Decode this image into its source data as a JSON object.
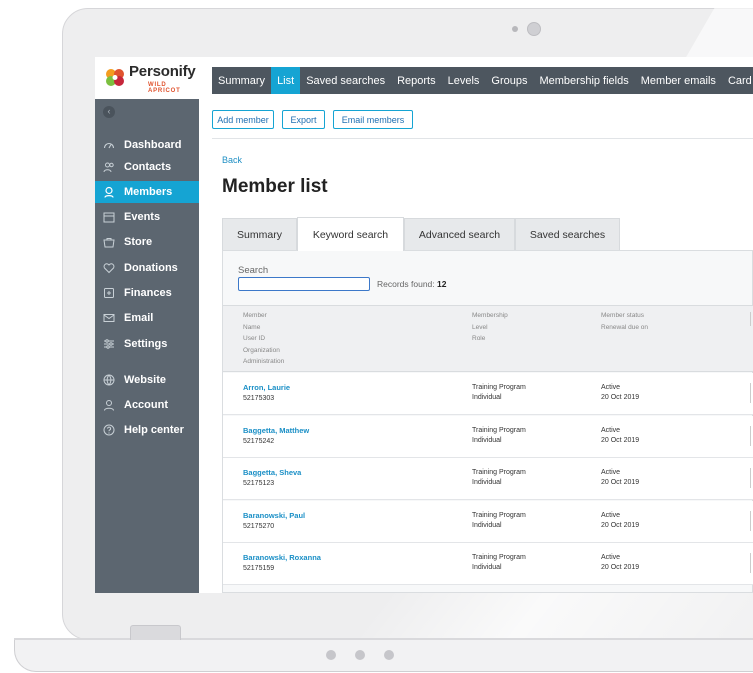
{
  "brand": {
    "name": "Personify",
    "sub": "WILD APRICOT"
  },
  "sidebar": {
    "collapse_glyph": "‹",
    "items": [
      {
        "label": "Dashboard",
        "icon": "dashboard-icon",
        "active": false
      },
      {
        "label": "Contacts",
        "icon": "contacts-icon",
        "active": false
      },
      {
        "label": "Members",
        "icon": "members-icon",
        "active": true
      },
      {
        "label": "Events",
        "icon": "calendar-icon",
        "active": false
      },
      {
        "label": "Store",
        "icon": "store-icon",
        "active": false
      },
      {
        "label": "Donations",
        "icon": "heart-icon",
        "active": false
      },
      {
        "label": "Finances",
        "icon": "finances-icon",
        "active": false
      },
      {
        "label": "Email",
        "icon": "email-icon",
        "active": false
      },
      {
        "label": "Settings",
        "icon": "settings-icon",
        "active": false
      },
      {
        "label": "Website",
        "icon": "globe-icon",
        "active": false
      },
      {
        "label": "Account",
        "icon": "account-icon",
        "active": false
      },
      {
        "label": "Help center",
        "icon": "help-icon",
        "active": false
      }
    ]
  },
  "topbar": {
    "items": [
      {
        "label": "Summary",
        "active": false
      },
      {
        "label": "List",
        "active": true
      },
      {
        "label": "Saved searches",
        "active": false
      },
      {
        "label": "Reports",
        "active": false
      },
      {
        "label": "Levels",
        "active": false
      },
      {
        "label": "Groups",
        "active": false
      },
      {
        "label": "Membership fields",
        "active": false
      },
      {
        "label": "Member emails",
        "active": false
      },
      {
        "label": "Card",
        "active": false
      }
    ]
  },
  "actions": {
    "add_member": "Add member",
    "export": "Export",
    "email_members": "Email members"
  },
  "page": {
    "back": "Back",
    "title": "Member list"
  },
  "tabs": [
    {
      "label": "Summary",
      "active": false
    },
    {
      "label": "Keyword search",
      "active": true
    },
    {
      "label": "Advanced search",
      "active": false
    },
    {
      "label": "Saved searches",
      "active": false
    }
  ],
  "search": {
    "label": "Search",
    "value": "",
    "records_label": "Records found:",
    "records_count": "12"
  },
  "table": {
    "headers": {
      "member": [
        "Member",
        "Name",
        "User ID",
        "Organization",
        "Administration"
      ],
      "membership": [
        "Membership",
        "Level",
        "Role"
      ],
      "status": [
        "Member status",
        "Renewal due on"
      ]
    },
    "rows": [
      {
        "name": "Arron, Laurie",
        "id": "52175303",
        "level": "Training Program",
        "role": "Individual",
        "status": "Active",
        "renewal": "20 Oct 2019"
      },
      {
        "name": "Baggetta, Matthew",
        "id": "52175242",
        "level": "Training Program",
        "role": "Individual",
        "status": "Active",
        "renewal": "20 Oct 2019"
      },
      {
        "name": "Baggetta, Sheva",
        "id": "52175123",
        "level": "Training Program",
        "role": "Individual",
        "status": "Active",
        "renewal": "20 Oct 2019"
      },
      {
        "name": "Baranowski, Paul",
        "id": "52175270",
        "level": "Training Program",
        "role": "Individual",
        "status": "Active",
        "renewal": "20 Oct 2019"
      },
      {
        "name": "Baranowski, Roxanna",
        "id": "52175159",
        "level": "Training Program",
        "role": "Individual",
        "status": "Active",
        "renewal": "20 Oct 2019"
      }
    ]
  },
  "colors": {
    "accent": "#15a4d3",
    "sidebar": "#5c6670",
    "topbar": "#4d565f",
    "link": "#1a8fc6"
  }
}
